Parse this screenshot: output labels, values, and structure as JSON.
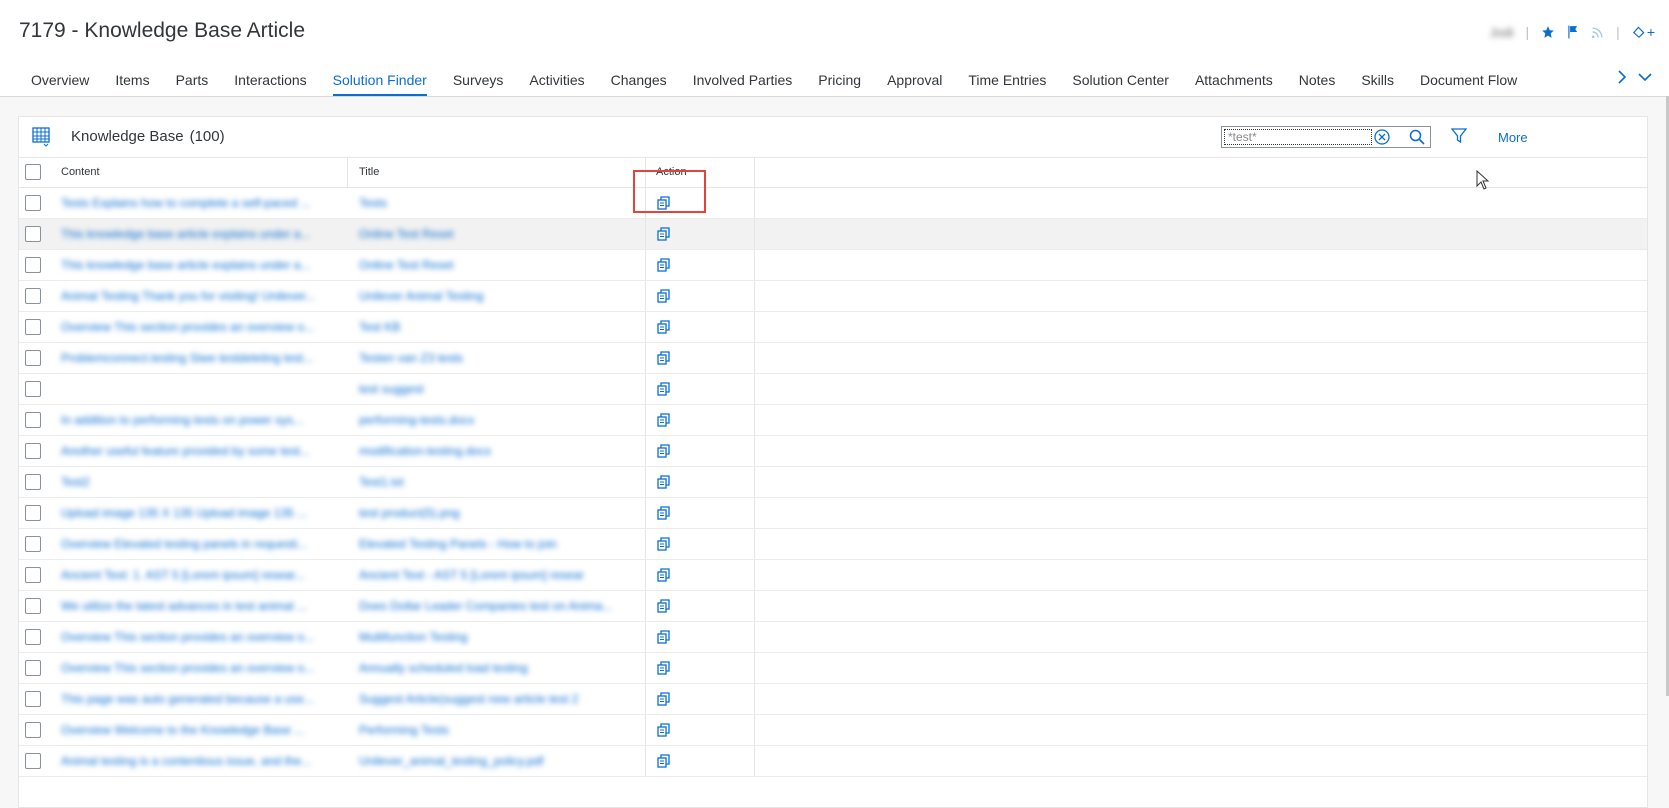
{
  "page": {
    "title": "7179 - Knowledge Base Article"
  },
  "header": {
    "user_name": "Jodi",
    "icons": [
      "star-icon",
      "flag-icon",
      "rss-icon",
      "share-icon"
    ],
    "plus_label": "+"
  },
  "tabs": [
    {
      "label": "Overview",
      "active": false
    },
    {
      "label": "Items",
      "active": false
    },
    {
      "label": "Parts",
      "active": false
    },
    {
      "label": "Interactions",
      "active": false
    },
    {
      "label": "Solution Finder",
      "active": true
    },
    {
      "label": "Surveys",
      "active": false
    },
    {
      "label": "Activities",
      "active": false
    },
    {
      "label": "Changes",
      "active": false
    },
    {
      "label": "Involved Parties",
      "active": false
    },
    {
      "label": "Pricing",
      "active": false
    },
    {
      "label": "Approval",
      "active": false
    },
    {
      "label": "Time Entries",
      "active": false
    },
    {
      "label": "Solution Center",
      "active": false
    },
    {
      "label": "Attachments",
      "active": false
    },
    {
      "label": "Notes",
      "active": false
    },
    {
      "label": "Skills",
      "active": false
    },
    {
      "label": "Document Flow",
      "active": false
    }
  ],
  "panel": {
    "title": "Knowledge Base",
    "count": "(100)",
    "search_value": "*test*",
    "more_label": "More"
  },
  "table": {
    "columns": [
      "Content",
      "Title",
      "Action"
    ],
    "rows": [
      {
        "content": "Tests Explains how to complete a self-paced ...",
        "title": "Tests"
      },
      {
        "content": "This knowledge base article explains under a...",
        "title": "Online Test Reset"
      },
      {
        "content": "This knowledge base article explains under a...",
        "title": "Online Test Reset"
      },
      {
        "content": "Animal Testing Thank you for visiting! Unilever...",
        "title": "Unilever Animal Testing"
      },
      {
        "content": "Overview This section provides an overview o...",
        "title": "Test KB"
      },
      {
        "content": "Problemconnect.testing Siwe testdeleting test...",
        "title": "Testen van Z3 tests"
      },
      {
        "content": "",
        "title": "test suggest"
      },
      {
        "content": "In addition to performing tests on power sys...",
        "title": "performing-tests.docx"
      },
      {
        "content": "Another useful feature provided by some test...",
        "title": "modification-testing.docx"
      },
      {
        "content": "Test2",
        "title": "Test1.txt"
      },
      {
        "content": "Upload image 135 X 135 Upload image 135 ...",
        "title": "test product(5).png"
      },
      {
        "content": "Overview Elevated testing panels in requesti...",
        "title": "Elevated Testing Panels - How to join"
      },
      {
        "content": "Ancient Text: 1. AST 5 [Lorem ipsum] resear...",
        "title": "Ancient Text - AST 5 [Lorem ipsum] resear"
      },
      {
        "content": "We utilize the latest advances in test animal ...",
        "title": "Does Dollar Leader Companies test on Anima..."
      },
      {
        "content": "Overview This section provides an overview o...",
        "title": "Multifunction Testing"
      },
      {
        "content": "Overview This section provides an overview o...",
        "title": "Annually scheduled load testing"
      },
      {
        "content": "This page was auto generated because a use...",
        "title": "Suggest Article(suggest new article test 2"
      },
      {
        "content": "Overview Welcome to the Knowledge Base ...",
        "title": "Performing Tests"
      },
      {
        "content": "Animal testing is a contentious issue, and the...",
        "title": "Unilever_animal_testing_policy.pdf"
      }
    ]
  }
}
